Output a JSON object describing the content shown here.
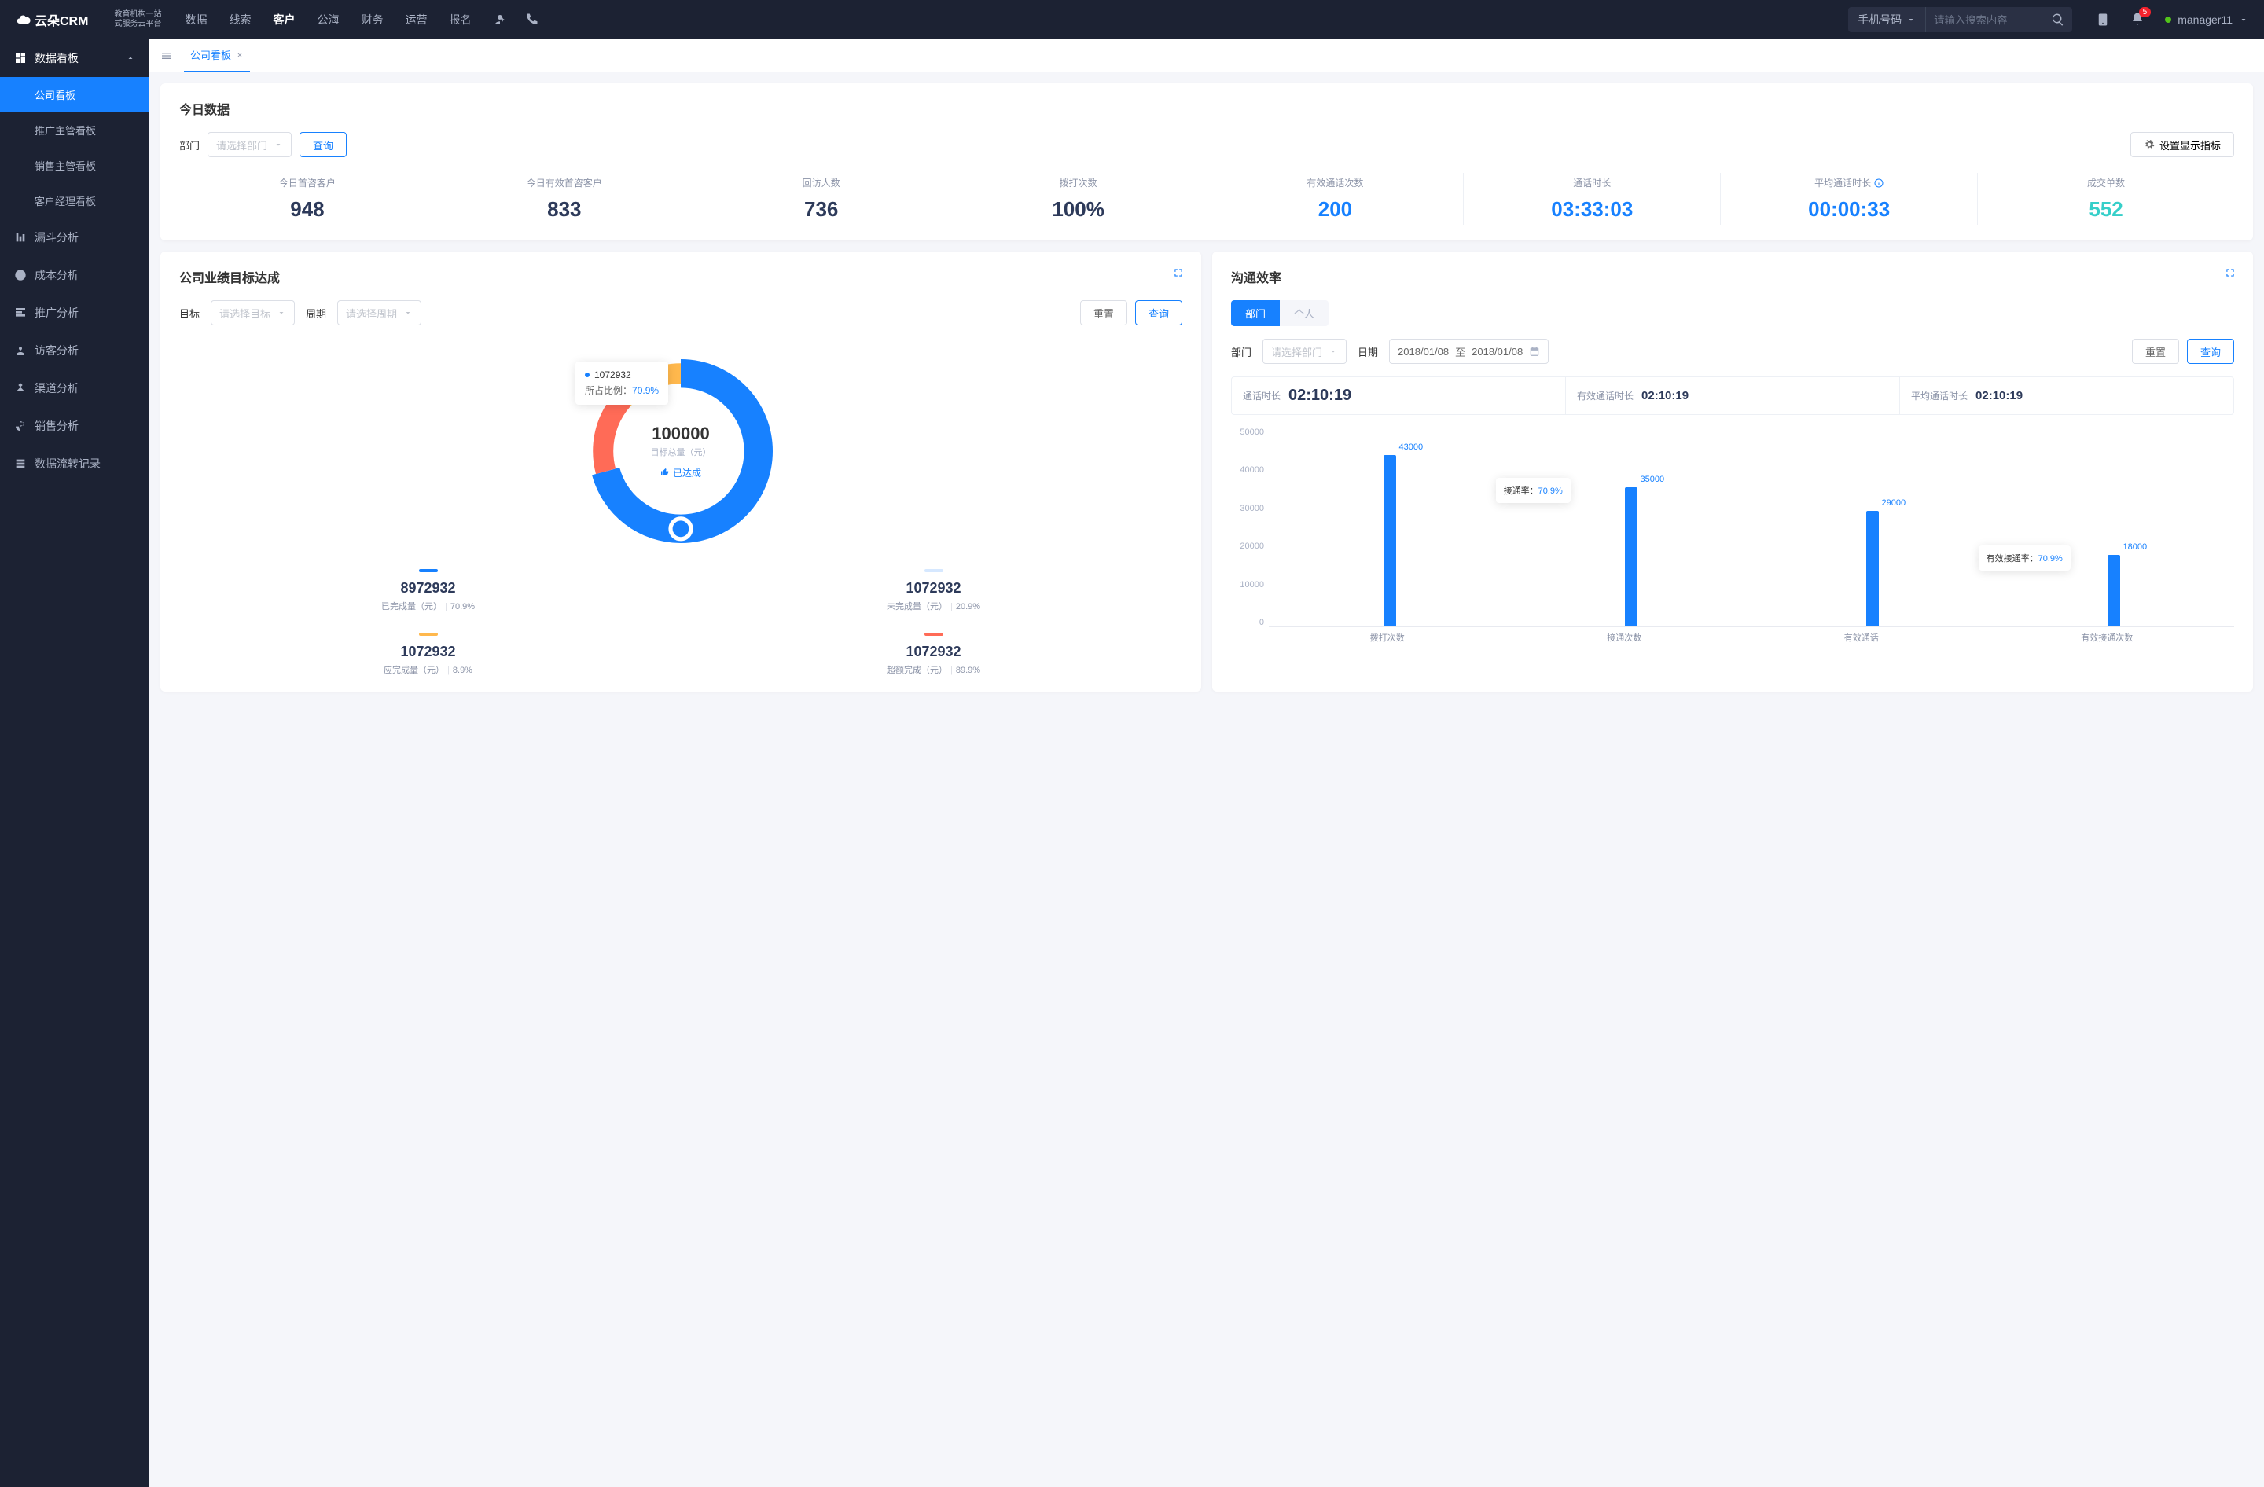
{
  "brand": {
    "name": "云朵CRM",
    "sub1": "教育机构一站",
    "sub2": "式服务云平台",
    "url": "www.yunduocrm.com"
  },
  "nav": {
    "items": [
      "数据",
      "线索",
      "客户",
      "公海",
      "财务",
      "运营",
      "报名"
    ],
    "active_index": 2
  },
  "search": {
    "type": "手机号码",
    "placeholder": "请输入搜索内容"
  },
  "notifications": {
    "count": "5"
  },
  "user": {
    "name": "manager11"
  },
  "sidebar": {
    "group": "数据看板",
    "subs": [
      "公司看板",
      "推广主管看板",
      "销售主管看板",
      "客户经理看板"
    ],
    "active_sub": 0,
    "items": [
      "漏斗分析",
      "成本分析",
      "推广分析",
      "访客分析",
      "渠道分析",
      "销售分析",
      "数据流转记录"
    ]
  },
  "tabs": {
    "active": "公司看板"
  },
  "today": {
    "title": "今日数据",
    "dept_label": "部门",
    "dept_placeholder": "请选择部门",
    "query": "查询",
    "settings": "设置显示指标",
    "kpis": [
      {
        "label": "今日首咨客户",
        "value": "948",
        "color": "c-dark"
      },
      {
        "label": "今日有效首咨客户",
        "value": "833",
        "color": "c-dark"
      },
      {
        "label": "回访人数",
        "value": "736",
        "color": "c-dark"
      },
      {
        "label": "拨打次数",
        "value": "100%",
        "color": "c-dark"
      },
      {
        "label": "有效通话次数",
        "value": "200",
        "color": "c-blue"
      },
      {
        "label": "通话时长",
        "value": "03:33:03",
        "color": "c-blue"
      },
      {
        "label": "平均通话时长",
        "value": "00:00:33",
        "color": "c-blue",
        "info": true
      },
      {
        "label": "成交单数",
        "value": "552",
        "color": "c-cyan"
      }
    ]
  },
  "goal": {
    "title": "公司业绩目标达成",
    "target_label": "目标",
    "target_placeholder": "请选择目标",
    "period_label": "周期",
    "period_placeholder": "请选择周期",
    "reset": "重置",
    "query": "查询",
    "tooltip": {
      "value": "1072932",
      "ratio_label": "所占比例：",
      "ratio": "70.9%"
    },
    "center": {
      "value": "100000",
      "sub": "目标总量（元）",
      "status": "已达成"
    },
    "legend": [
      {
        "color": "#1781ff",
        "value": "8972932",
        "label": "已完成量（元）",
        "pct": "70.9%"
      },
      {
        "color": "#d6e8ff",
        "value": "1072932",
        "label": "未完成量（元）",
        "pct": "20.9%"
      },
      {
        "color": "#ffb84d",
        "value": "1072932",
        "label": "应完成量（元）",
        "pct": "8.9%"
      },
      {
        "color": "#ff6b57",
        "value": "1072932",
        "label": "超额完成（元）",
        "pct": "89.9%"
      }
    ]
  },
  "comm": {
    "title": "沟通效率",
    "seg": {
      "dept": "部门",
      "person": "个人"
    },
    "dept_label": "部门",
    "dept_placeholder": "请选择部门",
    "date_label": "日期",
    "date_from": "2018/01/08",
    "date_to": "2018/01/08",
    "date_sep": "至",
    "reset": "重置",
    "query": "查询",
    "strip": [
      {
        "label": "通话时长",
        "value": "02:10:19",
        "big": true
      },
      {
        "label": "有效通话时长",
        "value": "02:10:19"
      },
      {
        "label": "平均通话时长",
        "value": "02:10:19"
      }
    ],
    "tips": [
      {
        "label": "接通率：",
        "value": "70.9%",
        "bar": 1
      },
      {
        "label": "有效接通率：",
        "value": "70.9%",
        "bar": 3
      }
    ]
  },
  "chart_data": {
    "donut": {
      "type": "pie",
      "title": "公司业绩目标达成",
      "center_value": 100000,
      "center_label": "目标总量（元）",
      "series": [
        {
          "name": "已完成量",
          "value": 8972932,
          "pct": 70.9,
          "color": "#1781ff"
        },
        {
          "name": "未完成量",
          "value": 1072932,
          "pct": 20.9,
          "color": "#d6e8ff"
        },
        {
          "name": "应完成量",
          "value": 1072932,
          "pct": 8.9,
          "color": "#ffb84d"
        },
        {
          "name": "超额完成",
          "value": 1072932,
          "pct": 89.9,
          "color": "#ff6b57"
        }
      ],
      "visible_arc_pct": {
        "blue": 70.9,
        "orange": 13,
        "red": 16.1
      }
    },
    "bars": {
      "type": "bar",
      "title": "沟通效率",
      "ylabel": "",
      "ylim": [
        0,
        50000
      ],
      "y_ticks": [
        0,
        10000,
        20000,
        30000,
        40000,
        50000
      ],
      "categories": [
        "拨打次数",
        "接通次数",
        "有效通话",
        "有效接通次数"
      ],
      "values": [
        43000,
        35000,
        29000,
        18000
      ],
      "annotations": [
        {
          "text": "接通率：70.9%",
          "between": [
            0,
            1
          ]
        },
        {
          "text": "有效接通率：70.9%",
          "between": [
            2,
            3
          ]
        }
      ]
    }
  }
}
